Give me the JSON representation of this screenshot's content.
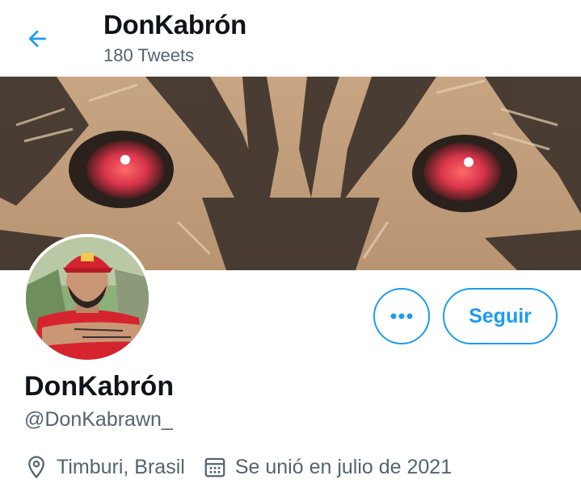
{
  "header": {
    "title": "DonKabrón",
    "tweet_count": "180 Tweets",
    "back_icon": "arrow-left-icon",
    "accent_color": "#1d9bf0"
  },
  "banner": {
    "description_icon": "tiger-eyes-banner-image"
  },
  "profile": {
    "avatar_icon": "profile-photo-avatar",
    "display_name": "DonKabrón",
    "handle": "@DonKabrawn_",
    "location": "Timburi, Brasil",
    "joined": "Se unió en julio de 2021",
    "location_icon": "location-pin-icon",
    "calendar_icon": "calendar-icon"
  },
  "actions": {
    "more_icon": "more-dots-icon",
    "follow_label": "Seguir"
  }
}
